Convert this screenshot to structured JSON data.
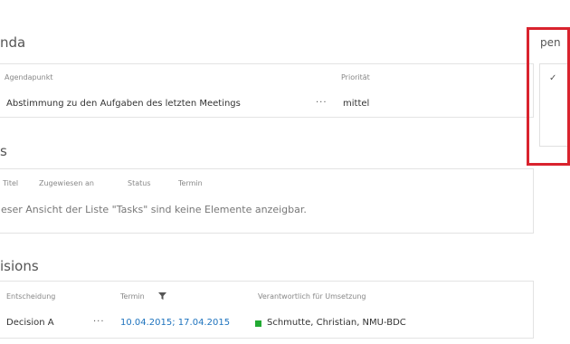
{
  "agenda": {
    "title": "nda",
    "headers": {
      "item": "Agendapunkt",
      "priority": "Priorität"
    },
    "rows": [
      {
        "item": "Abstimmung zu den Aufgaben des letzten Meetings",
        "ellipsis": "···",
        "priority": "mittel"
      }
    ]
  },
  "tasks": {
    "title": "s",
    "headers": [
      "Titel",
      "Zugewiesen an",
      "Status",
      "Termin"
    ],
    "empty_message": "eser Ansicht der Liste \"Tasks\" sind keine Elemente anzeigbar."
  },
  "decisions": {
    "title": "isions",
    "headers": {
      "decision": "Entscheidung",
      "date": "Termin",
      "responsible": "Verantwortlich für Umsetzung"
    },
    "rows": [
      {
        "decision": "Decision A",
        "ellipsis": "···",
        "date": "10.04.2015; 17.04.2015",
        "responsible": "Schmutte, Christian, NMU-BDC"
      }
    ]
  },
  "side": {
    "title": "pen",
    "check": "✓"
  },
  "colors": {
    "link": "#1e73be",
    "highlight": "#d9232e",
    "status": "#22aa33"
  },
  "icons": {
    "filter": "filter-icon",
    "check": "check-icon"
  }
}
